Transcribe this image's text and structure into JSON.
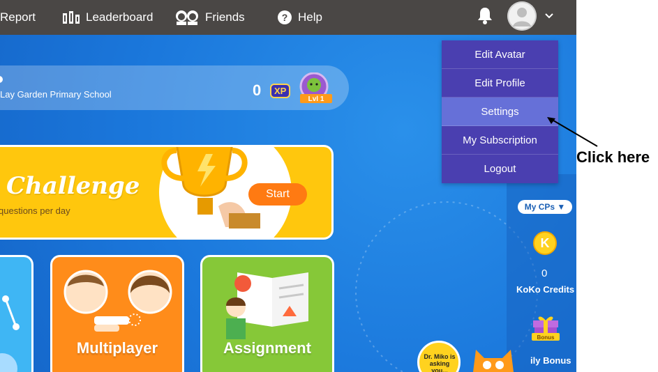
{
  "nav": {
    "report": "Report",
    "leaderboard": "Leaderboard",
    "friends": "Friends",
    "help": "Help"
  },
  "profile": {
    "school": "Lay Garden Primary School",
    "xp_value": "0",
    "xp_badge": "XP",
    "level_label": "Lvl 1"
  },
  "challenge": {
    "title": "Challenge",
    "subtitle": "questions per day",
    "start_label": "Start"
  },
  "cards": {
    "multiplayer": "Multiplayer",
    "assignment": "Assignment"
  },
  "dropdown": {
    "items": [
      "Edit Avatar",
      "Edit Profile",
      "Settings",
      "My Subscription",
      "Logout"
    ],
    "highlighted": "Settings"
  },
  "side": {
    "mycps_label": "My CPs ▼",
    "koko_symbol": "K",
    "koko_value": "0",
    "koko_label": "KoKo Credits",
    "bonus_badge": "Bonus",
    "bonus_label": "ily Bonus"
  },
  "miko": {
    "text": "Dr. Miko is asking you..."
  },
  "annotation": {
    "text": "Click here"
  },
  "colors": {
    "nav_bg": "#4a4745",
    "app_blue": "#1e7fe0",
    "dropdown_bg": "#4a3fb0",
    "dropdown_highlight": "#6670d8",
    "challenge_yellow": "#ffc70d",
    "start_orange": "#ff7a12",
    "multiplayer_orange": "#ff8c1a",
    "assignment_green": "#86c838"
  }
}
